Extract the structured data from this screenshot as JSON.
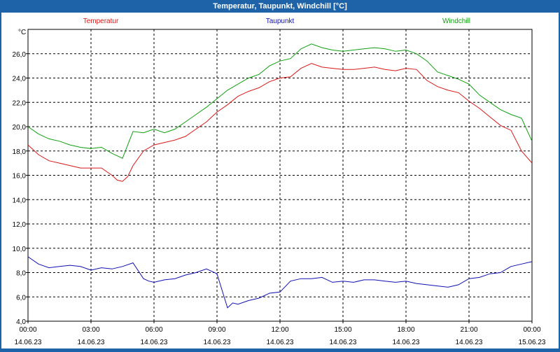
{
  "window": {
    "title": "Temperatur, Taupunkt, Windchill [°C]"
  },
  "chart_data": {
    "type": "line",
    "title": "Temperatur, Taupunkt, Windchill [°C]",
    "ylabel": "°C",
    "ylim": [
      4,
      28
    ],
    "yticks": [
      "4,0",
      "6,0",
      "8,0",
      "10,0",
      "12,0",
      "14,0",
      "16,0",
      "18,0",
      "20,0",
      "22,0",
      "24,0",
      "26,0"
    ],
    "ytick_values": [
      4,
      6,
      8,
      10,
      12,
      14,
      16,
      18,
      20,
      22,
      24,
      26
    ],
    "xlim": [
      0,
      24
    ],
    "xticks": [
      {
        "time": "00:00",
        "date": "14.06.23",
        "hour": 0
      },
      {
        "time": "03:00",
        "date": "14.06.23",
        "hour": 3
      },
      {
        "time": "06:00",
        "date": "14.06.23",
        "hour": 6
      },
      {
        "time": "09:00",
        "date": "14.06.23",
        "hour": 9
      },
      {
        "time": "12:00",
        "date": "14.06.23",
        "hour": 12
      },
      {
        "time": "15:00",
        "date": "14.06.23",
        "hour": 15
      },
      {
        "time": "18:00",
        "date": "14.06.23",
        "hour": 18
      },
      {
        "time": "21:00",
        "date": "14.06.23",
        "hour": 21
      },
      {
        "time": "00:00",
        "date": "15.06.23",
        "hour": 24
      }
    ],
    "grid": true,
    "legend": "top",
    "series": [
      {
        "name": "Temperatur",
        "color": "#d81818",
        "x": [
          0,
          0.5,
          1,
          1.5,
          2,
          2.5,
          3,
          3.5,
          4,
          4.25,
          4.5,
          4.75,
          5,
          5.5,
          6,
          6.5,
          7,
          7.5,
          8,
          8.5,
          9,
          9.5,
          10,
          10.5,
          11,
          11.5,
          12,
          12.5,
          13,
          13.5,
          14,
          14.5,
          15,
          15.5,
          16,
          16.5,
          17,
          17.5,
          18,
          18.5,
          19,
          19.5,
          20,
          20.5,
          21,
          21.5,
          22,
          22.5,
          23,
          23.5,
          24
        ],
        "values": [
          18.5,
          17.7,
          17.2,
          17.0,
          16.8,
          16.6,
          16.6,
          16.6,
          16.0,
          15.6,
          15.5,
          15.9,
          16.8,
          18.0,
          18.5,
          18.7,
          18.9,
          19.2,
          19.8,
          20.4,
          21.2,
          21.8,
          22.5,
          22.9,
          23.2,
          23.7,
          24.0,
          24.1,
          24.8,
          25.2,
          24.9,
          24.8,
          24.7,
          24.7,
          24.8,
          24.9,
          24.7,
          24.6,
          24.8,
          24.7,
          23.8,
          23.3,
          23.0,
          22.8,
          22.1,
          21.5,
          20.8,
          20.1,
          19.7,
          18.0,
          17.0
        ]
      },
      {
        "name": "Taupunkt",
        "color": "#1010b0",
        "x": [
          0,
          0.5,
          1,
          1.5,
          2,
          2.5,
          3,
          3.5,
          4,
          4.5,
          5,
          5.5,
          5.75,
          6,
          6.5,
          7,
          7.5,
          8,
          8.5,
          9,
          9.25,
          9.5,
          9.75,
          10,
          10.5,
          11,
          11.5,
          12,
          12.5,
          13,
          13.5,
          14,
          14.5,
          15,
          15.5,
          16,
          16.5,
          17,
          17.5,
          18,
          18.5,
          19,
          19.5,
          20,
          20.5,
          21,
          21.5,
          22,
          22.5,
          23,
          23.5,
          24
        ],
        "values": [
          9.3,
          8.7,
          8.4,
          8.5,
          8.6,
          8.5,
          8.2,
          8.4,
          8.3,
          8.5,
          8.8,
          7.5,
          7.3,
          7.2,
          7.4,
          7.5,
          7.8,
          8.0,
          8.3,
          7.9,
          6.5,
          5.1,
          5.5,
          5.4,
          5.7,
          5.9,
          6.3,
          6.4,
          7.3,
          7.5,
          7.5,
          7.6,
          7.2,
          7.3,
          7.2,
          7.4,
          7.4,
          7.3,
          7.2,
          7.3,
          7.1,
          7.0,
          6.9,
          6.8,
          7.0,
          7.5,
          7.6,
          7.9,
          8.0,
          8.5,
          8.7,
          8.9
        ]
      },
      {
        "name": "Windchill",
        "color": "#10a010",
        "x": [
          0,
          0.5,
          1,
          1.5,
          2,
          2.5,
          3,
          3.5,
          4,
          4.5,
          5,
          5.5,
          6,
          6.5,
          7,
          7.5,
          8,
          8.5,
          9,
          9.5,
          10,
          10.5,
          11,
          11.5,
          12,
          12.5,
          13,
          13.5,
          14,
          14.5,
          15,
          15.5,
          16,
          16.5,
          17,
          17.5,
          18,
          18.5,
          19,
          19.5,
          20,
          20.5,
          21,
          21.5,
          22,
          22.5,
          23,
          23.5,
          24
        ],
        "values": [
          20.0,
          19.4,
          19.0,
          18.8,
          18.5,
          18.3,
          18.2,
          18.3,
          17.8,
          17.4,
          19.6,
          19.5,
          19.8,
          19.5,
          19.8,
          20.4,
          21.0,
          21.6,
          22.3,
          23.0,
          23.5,
          24.0,
          24.3,
          25.0,
          25.4,
          25.6,
          26.4,
          26.8,
          26.5,
          26.3,
          26.2,
          26.3,
          26.4,
          26.5,
          26.4,
          26.2,
          26.3,
          26.0,
          25.4,
          24.5,
          24.2,
          23.9,
          23.5,
          22.6,
          22.0,
          21.4,
          21.0,
          20.7,
          18.8
        ]
      }
    ]
  }
}
